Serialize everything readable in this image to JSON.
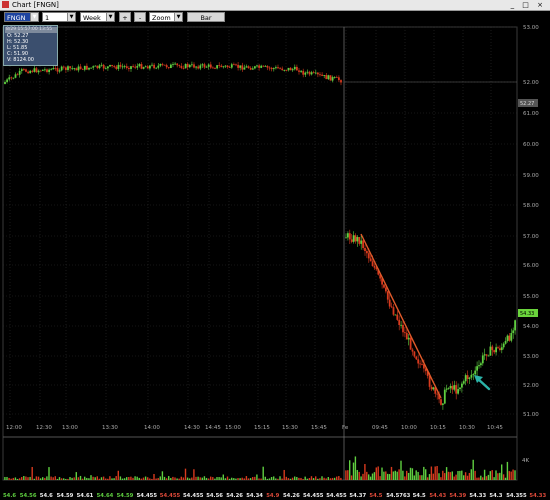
{
  "window": {
    "title": "Chart [FNGN]",
    "controls": "_ □ ×"
  },
  "toolbar": {
    "symbol": "FNGN",
    "interval": "1 minute",
    "period": "Week",
    "plus": "+",
    "minus": "-",
    "zoom": "Zoom",
    "bar": "Bar"
  },
  "ohlc": {
    "header": "8/29 15:57:00 13:55",
    "open": "O: 52.27",
    "high": "H: 52.30",
    "low": "L: 51.85",
    "close": "C: 51.90",
    "volume": "V: 8124.00"
  },
  "price_labels": [
    "53.00",
    "52.00",
    "61.00",
    "60.00",
    "59.00",
    "58.00",
    "57.00",
    "56.00",
    "55.00",
    "54.00",
    "53.00",
    "52.00",
    "51.00"
  ],
  "price_tags": {
    "prev_close": "52.27",
    "last": "54.33"
  },
  "time_labels": [
    "12:00",
    "12:30",
    "13:00",
    "13:30",
    "14:00",
    "14:30",
    "14:45",
    "15:00",
    "15:15",
    "15:30",
    "15:45",
    "Fe",
    "09:45",
    "10:00",
    "10:15",
    "10:30",
    "10:45"
  ],
  "volume_label": "4K",
  "ticker": [
    {
      "v": "54.6",
      "c": "g"
    },
    {
      "v": "54.56",
      "c": "g"
    },
    {
      "v": "54.6",
      "c": "w"
    },
    {
      "v": "54.59",
      "c": "w"
    },
    {
      "v": "54.61",
      "c": "w"
    },
    {
      "v": "54.64",
      "c": "g"
    },
    {
      "v": "54.59",
      "c": "g"
    },
    {
      "v": "54.455",
      "c": "w"
    },
    {
      "v": "54.455",
      "c": "r"
    },
    {
      "v": "54.455",
      "c": "w"
    },
    {
      "v": "54.56",
      "c": "w"
    },
    {
      "v": "54.26",
      "c": "w"
    },
    {
      "v": "54.34",
      "c": "w"
    },
    {
      "v": "54.9",
      "c": "r"
    },
    {
      "v": "54.26",
      "c": "w"
    },
    {
      "v": "54.455",
      "c": "w"
    },
    {
      "v": "54.455",
      "c": "w"
    },
    {
      "v": "54.37",
      "c": "w"
    },
    {
      "v": "54.5",
      "c": "r"
    },
    {
      "v": "54.5763",
      "c": "w"
    },
    {
      "v": "54.5",
      "c": "w"
    },
    {
      "v": "54.43",
      "c": "r"
    },
    {
      "v": "54.39",
      "c": "r"
    },
    {
      "v": "54.33",
      "c": "w"
    },
    {
      "v": "54.3",
      "c": "w"
    },
    {
      "v": "54.355",
      "c": "w"
    },
    {
      "v": "54.33",
      "c": "r"
    }
  ],
  "colors": {
    "up": "#5fcf40",
    "down": "#d83a1e",
    "trendline": "#e05a2a",
    "arrow": "#2bb3a8",
    "grid": "#2c2c2c",
    "last_tag": "#6ad43c"
  }
}
